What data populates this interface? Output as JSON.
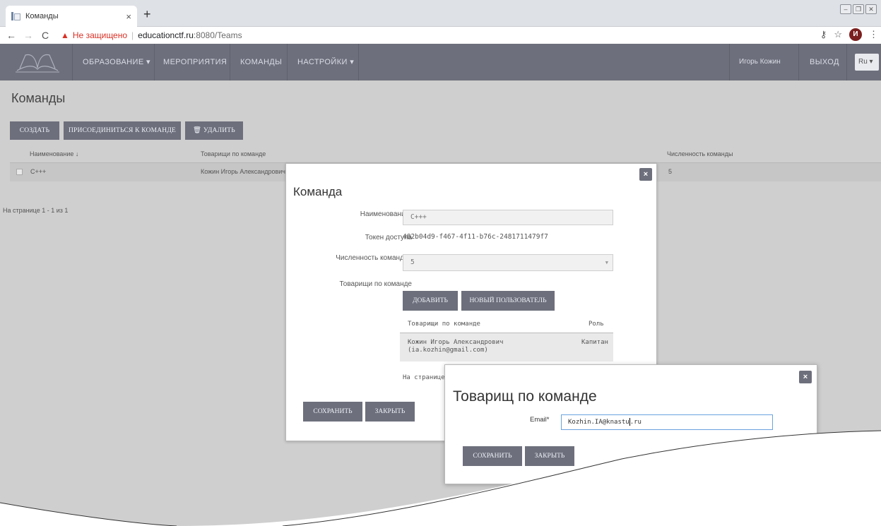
{
  "browser": {
    "tab_title": "Команды",
    "tab_close": "×",
    "new_tab": "+",
    "insecure_label": "Не защищено",
    "url_host": "educationctf.ru",
    "url_path": ":8080/Teams",
    "profile_initial": "И",
    "back_icon": "←",
    "forward_icon": "→",
    "reload_icon": "C",
    "key_icon": "⚷",
    "star_icon": "☆",
    "menu_icon": "⋮"
  },
  "nav": {
    "items": [
      "ОБРАЗОВАНИЕ ▾",
      "МЕРОПРИЯТИЯ",
      "КОМАНДЫ",
      "НАСТРОЙКИ ▾"
    ],
    "user": "Игорь Кожин",
    "logout": "ВЫХОД",
    "lang": "Ru ▾",
    "colors": {
      "nav_bg": "#6d6f7c",
      "button_bg": "#6d6f7c"
    }
  },
  "page": {
    "title": "Команды",
    "buttons": {
      "create": "СОЗДАТЬ",
      "join": "ПРИСОЕДИНИТЬСЯ К КОМАНДЕ",
      "delete": "🗑 УДАЛИТЬ"
    },
    "grid": {
      "columns": [
        "Наименование ↓",
        "Товарищи по команде",
        "Численность команды"
      ],
      "rows": [
        {
          "name": "С+++",
          "members": "Кожин Игорь Александрович",
          "size": "5"
        }
      ]
    },
    "pager": "На странице 1 - 1 из 1"
  },
  "dialog1": {
    "close": "×",
    "title": "Команда",
    "name_label": "Наименование*",
    "name_value": "С+++",
    "token_label": "Токен доступа",
    "token_value": "482b04d9-f467-4f11-b76c-2481711479f7",
    "size_label": "Численность команды*",
    "size_value": "5",
    "members_label": "Товарищи по команде",
    "add_button": "ДОБАВИТЬ",
    "new_user_button": "НОВЫЙ ПОЛЬЗОВАТЕЛЬ",
    "table_headers": [
      "Товарищи по команде",
      "Роль"
    ],
    "member_name": "Кожин Игорь Александрович",
    "member_email": "(ia.kozhin@gmail.com)",
    "member_role": "Капитан",
    "pager": "На странице",
    "save": "СОХРАНИТЬ",
    "close_button": "ЗАКРЫТЬ"
  },
  "dialog2": {
    "close": "×",
    "title": "Товарищ по команде",
    "email_label": "Email*",
    "email_before_caret": "Kozhin.IA@knastu",
    "email_after_caret": ".ru",
    "save": "СОХРАНИТЬ",
    "close_button": "ЗАКРЫТЬ"
  }
}
